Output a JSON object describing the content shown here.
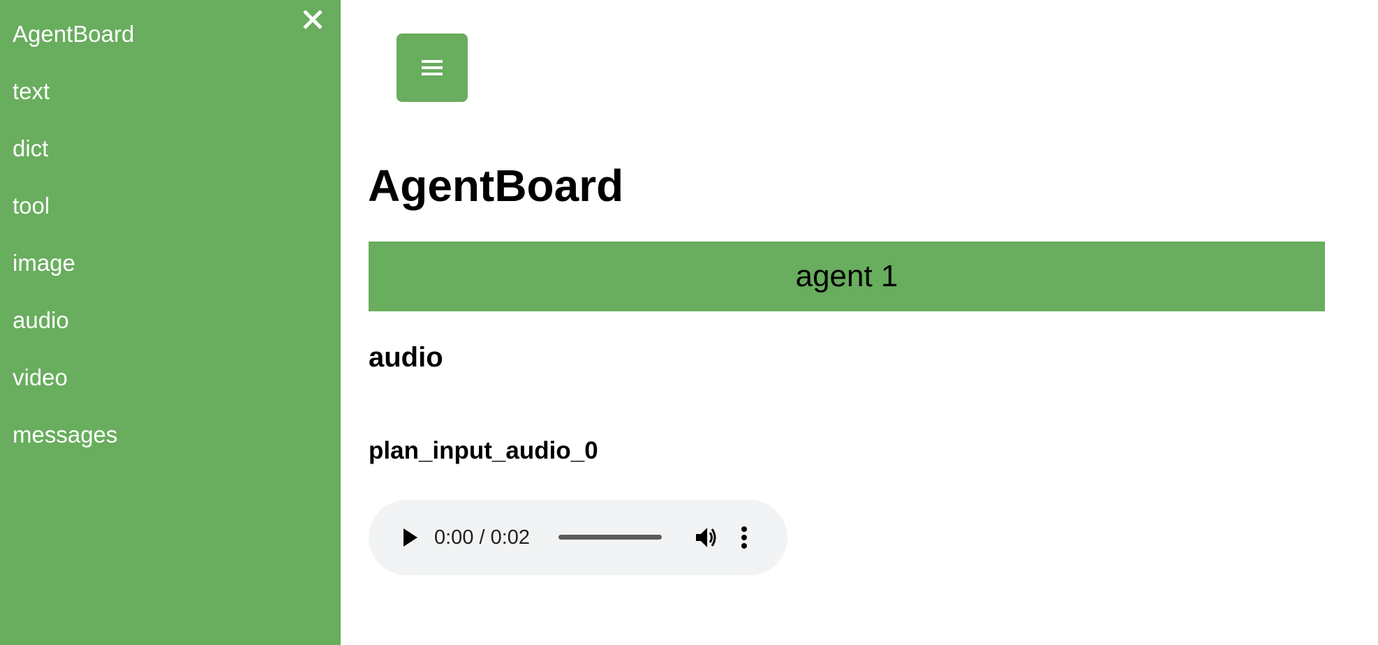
{
  "colors": {
    "accent": "#69ad5e",
    "player_bg": "#f1f3f4"
  },
  "sidebar": {
    "close_icon": "close-icon",
    "items": [
      {
        "label": "AgentBoard"
      },
      {
        "label": "text"
      },
      {
        "label": "dict"
      },
      {
        "label": "tool"
      },
      {
        "label": "image"
      },
      {
        "label": "audio"
      },
      {
        "label": "video"
      },
      {
        "label": "messages"
      }
    ]
  },
  "header": {
    "menu_icon": "hamburger-menu-icon",
    "title": "AgentBoard"
  },
  "main": {
    "agent_label": "agent 1",
    "section_heading": "audio",
    "audio_items": [
      {
        "name": "plan_input_audio_0",
        "player": {
          "current_time": "0:00",
          "duration": "0:02",
          "time_display": "0:00 / 0:02",
          "progress_fraction": 0,
          "play_icon": "play-icon",
          "volume_icon": "volume-icon",
          "more_icon": "more-vertical-icon"
        }
      }
    ]
  }
}
